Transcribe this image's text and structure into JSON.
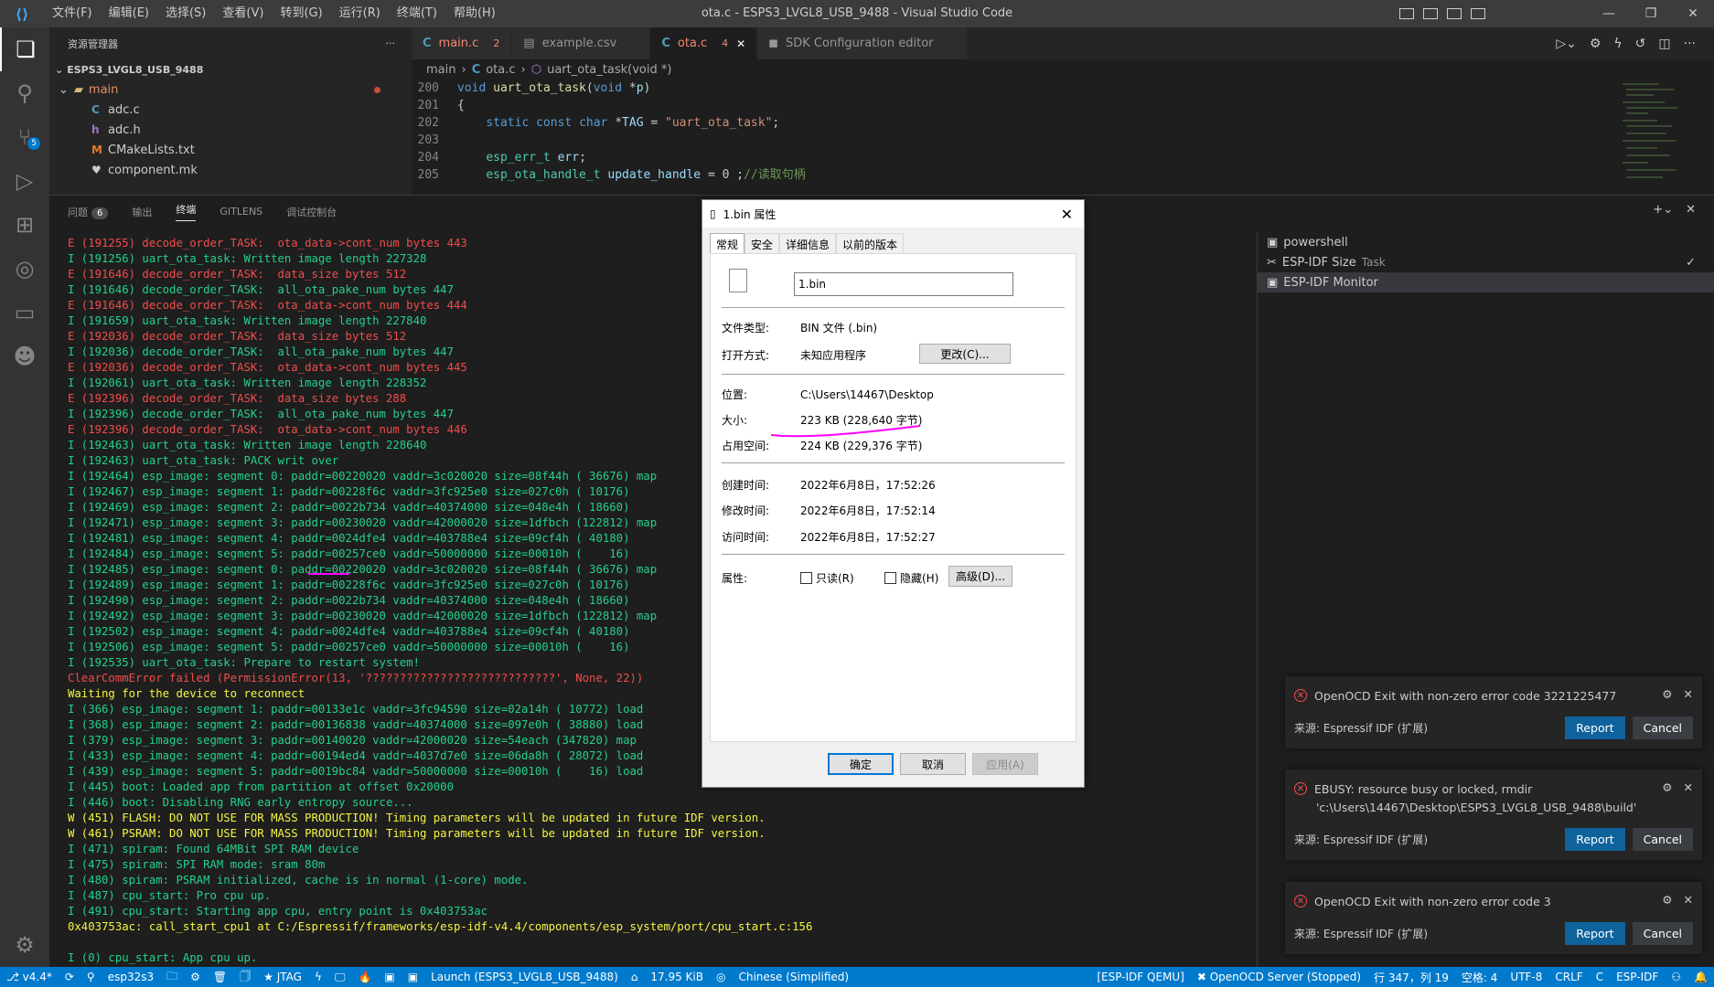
{
  "titlebar": {
    "menu": [
      "文件(F)",
      "编辑(E)",
      "选择(S)",
      "查看(V)",
      "转到(G)",
      "运行(R)",
      "终端(T)",
      "帮助(H)"
    ],
    "title": "ota.c - ESPS3_LVGL8_USB_9488 - Visual Studio Code"
  },
  "activity": {
    "scm_badge": "5"
  },
  "sidebar": {
    "title": "资源管理器",
    "more": "···",
    "project": "ESPS3_LVGL8_USB_9488",
    "folder": "main",
    "files": [
      {
        "icon": "C",
        "name": "adc.c",
        "color": "#519aba"
      },
      {
        "icon": "h",
        "name": "adc.h",
        "color": "#a074c4"
      },
      {
        "icon": "M",
        "name": "CMakeLists.txt",
        "color": "#e37933"
      },
      {
        "icon": "♥",
        "name": "component.mk",
        "color": "#cccccc"
      }
    ]
  },
  "tabs": [
    {
      "icon": "C",
      "label": "main.c",
      "suffix": "2",
      "color": "#f48771",
      "active": false
    },
    {
      "icon": "▤",
      "label": "example.csv",
      "suffix": "",
      "color": "#969696",
      "active": false
    },
    {
      "icon": "C",
      "label": "ota.c",
      "suffix": "4",
      "color": "#f48771",
      "active": true
    },
    {
      "icon": "◼",
      "label": "SDK Configuration editor",
      "suffix": "",
      "color": "#969696",
      "active": false
    }
  ],
  "breadcrumb": {
    "a": "main",
    "b": "ota.c",
    "c": "uart_ota_task(void *)"
  },
  "code": [
    {
      "n": "200",
      "html": "void uart_ota_task(void *p)"
    },
    {
      "n": "201",
      "html": "{"
    },
    {
      "n": "202",
      "html": "    static const char *TAG = \"uart_ota_task\";"
    },
    {
      "n": "203",
      "html": ""
    },
    {
      "n": "204",
      "html": "    esp_err_t err;"
    },
    {
      "n": "205",
      "html": "    esp_ota_handle_t update_handle = 0 ;//读取句柄"
    }
  ],
  "panel": {
    "tabs": [
      "问题",
      "输出",
      "终端",
      "GITLENS",
      "调试控制台"
    ],
    "problems_count": "6",
    "active_tab": "终端"
  },
  "terminal_lines": [
    {
      "c": "red",
      "t": "E (191255) decode_order_TASK:  ota_data->cont_num bytes 443"
    },
    {
      "c": "green",
      "t": "I (191256) uart_ota_task: Written image length 227328"
    },
    {
      "c": "red",
      "t": "E (191646) decode_order_TASK:  data_size bytes 512"
    },
    {
      "c": "green",
      "t": "I (191646) decode_order_TASK:  all_ota_pake_num bytes 447"
    },
    {
      "c": "red",
      "t": "E (191646) decode_order_TASK:  ota_data->cont_num bytes 444"
    },
    {
      "c": "green",
      "t": "I (191659) uart_ota_task: Written image length 227840"
    },
    {
      "c": "red",
      "t": "E (192036) decode_order_TASK:  data_size bytes 512"
    },
    {
      "c": "green",
      "t": "I (192036) decode_order_TASK:  all_ota_pake_num bytes 447"
    },
    {
      "c": "red",
      "t": "E (192036) decode_order_TASK:  ota_data->cont_num bytes 445"
    },
    {
      "c": "green",
      "t": "I (192061) uart_ota_task: Written image length 228352"
    },
    {
      "c": "red",
      "t": "E (192396) decode_order_TASK:  data_size bytes 288"
    },
    {
      "c": "green",
      "t": "I (192396) decode_order_TASK:  all_ota_pake_num bytes 447"
    },
    {
      "c": "red",
      "t": "E (192396) decode_order_TASK:  ota_data->cont_num bytes 446"
    },
    {
      "c": "green",
      "t": "I (192463) uart_ota_task: Written image length 228640"
    },
    {
      "c": "green",
      "t": "I (192463) uart_ota_task: PACK writ over"
    },
    {
      "c": "green",
      "t": "I (192464) esp_image: segment 0: paddr=00220020 vaddr=3c020020 size=08f44h ( 36676) map"
    },
    {
      "c": "green",
      "t": "I (192467) esp_image: segment 1: paddr=00228f6c vaddr=3fc925e0 size=027c0h ( 10176)"
    },
    {
      "c": "green",
      "t": "I (192469) esp_image: segment 2: paddr=0022b734 vaddr=40374000 size=048e4h ( 18660)"
    },
    {
      "c": "green",
      "t": "I (192471) esp_image: segment 3: paddr=00230020 vaddr=42000020 size=1dfbch (122812) map"
    },
    {
      "c": "green",
      "t": "I (192481) esp_image: segment 4: paddr=0024dfe4 vaddr=403788e4 size=09cf4h ( 40180)"
    },
    {
      "c": "green",
      "t": "I (192484) esp_image: segment 5: paddr=00257ce0 vaddr=50000000 size=00010h (    16)"
    },
    {
      "c": "green",
      "t": "I (192485) esp_image: segment 0: paddr=00220020 vaddr=3c020020 size=08f44h ( 36676) map"
    },
    {
      "c": "green",
      "t": "I (192489) esp_image: segment 1: paddr=00228f6c vaddr=3fc925e0 size=027c0h ( 10176)"
    },
    {
      "c": "green",
      "t": "I (192490) esp_image: segment 2: paddr=0022b734 vaddr=40374000 size=048e4h ( 18660)"
    },
    {
      "c": "green",
      "t": "I (192492) esp_image: segment 3: paddr=00230020 vaddr=42000020 size=1dfbch (122812) map"
    },
    {
      "c": "green",
      "t": "I (192502) esp_image: segment 4: paddr=0024dfe4 vaddr=403788e4 size=09cf4h ( 40180)"
    },
    {
      "c": "green",
      "t": "I (192506) esp_image: segment 5: paddr=00257ce0 vaddr=50000000 size=00010h (    16)"
    },
    {
      "c": "green",
      "t": "I (192535) uart_ota_task: Prepare to restart system!"
    },
    {
      "c": "red",
      "t": "ClearCommError failed (PermissionError(13, '????????????????????????????', None, 22))"
    },
    {
      "c": "yellow",
      "t": "Waiting for the device to reconnect"
    },
    {
      "c": "green",
      "t": "I (366) esp_image: segment 1: paddr=00133e1c vaddr=3fc94590 size=02a14h ( 10772) load"
    },
    {
      "c": "green",
      "t": "I (368) esp_image: segment 2: paddr=00136838 vaddr=40374000 size=097e0h ( 38880) load"
    },
    {
      "c": "green",
      "t": "I (379) esp_image: segment 3: paddr=00140020 vaddr=42000020 size=54each (347820) map"
    },
    {
      "c": "green",
      "t": "I (433) esp_image: segment 4: paddr=00194ed4 vaddr=4037d7e0 size=06da8h ( 28072) load"
    },
    {
      "c": "green",
      "t": "I (439) esp_image: segment 5: paddr=0019bc84 vaddr=50000000 size=00010h (    16) load"
    },
    {
      "c": "green",
      "t": "I (445) boot: Loaded app from partition at offset 0x20000"
    },
    {
      "c": "green",
      "t": "I (446) boot: Disabling RNG early entropy source..."
    },
    {
      "c": "yellow",
      "t": "W (451) FLASH: DO NOT USE FOR MASS PRODUCTION! Timing parameters will be updated in future IDF version."
    },
    {
      "c": "yellow",
      "t": "W (461) PSRAM: DO NOT USE FOR MASS PRODUCTION! Timing parameters will be updated in future IDF version."
    },
    {
      "c": "green",
      "t": "I (471) spiram: Found 64MBit SPI RAM device"
    },
    {
      "c": "green",
      "t": "I (475) spiram: SPI RAM mode: sram 80m"
    },
    {
      "c": "green",
      "t": "I (480) spiram: PSRAM initialized, cache is in normal (1-core) mode."
    },
    {
      "c": "green",
      "t": "I (487) cpu_start: Pro cpu up."
    },
    {
      "c": "green",
      "t": "I (491) cpu_start: Starting app cpu, entry point is 0x403753ac"
    },
    {
      "c": "yellow",
      "t": "0x403753ac: call_start_cpu1 at C:/Espressif/frameworks/esp-idf-v4.4/components/esp_system/port/cpu_start.c:156"
    },
    {
      "c": "plain",
      "t": ""
    },
    {
      "c": "green",
      "t": "I (0) cpu_start: App cpu up."
    }
  ],
  "terminals": [
    {
      "name": "powershell",
      "sub": "",
      "sel": false,
      "check": false
    },
    {
      "name": "ESP-IDF Size",
      "sub": "Task",
      "sel": false,
      "check": true
    },
    {
      "name": "ESP-IDF Monitor",
      "sub": "",
      "sel": true,
      "check": false
    }
  ],
  "notifications": [
    {
      "msg": "OpenOCD Exit with non-zero error code 3221225477",
      "msg2": "",
      "source": "来源: Espressif IDF (扩展)",
      "report": "Report",
      "cancel": "Cancel"
    },
    {
      "msg": "EBUSY: resource busy or locked, rmdir",
      "msg2": "'c:\\Users\\14467\\Desktop\\ESPS3_LVGL8_USB_9488\\build'",
      "source": "来源: Espressif IDF (扩展)",
      "report": "Report",
      "cancel": "Cancel"
    },
    {
      "msg": "OpenOCD Exit with non-zero error code 3",
      "msg2": "",
      "source": "来源: Espressif IDF (扩展)",
      "report": "Report",
      "cancel": "Cancel"
    }
  ],
  "dialog": {
    "title": "1.bin 属性",
    "tabs": [
      "常规",
      "安全",
      "详细信息",
      "以前的版本"
    ],
    "filename": "1.bin",
    "type_label": "文件类型:",
    "type_value": "BIN 文件 (.bin)",
    "open_label": "打开方式:",
    "open_value": "未知应用程序",
    "change_btn": "更改(C)...",
    "loc_label": "位置:",
    "loc_value": "C:\\Users\\14467\\Desktop",
    "size_label": "大小:",
    "size_value": "223 KB (228,640 字节)",
    "disk_label": "占用空间:",
    "disk_value": "224 KB (229,376 字节)",
    "created_label": "创建时间:",
    "created_value": "2022年6月8日，17:52:26",
    "modified_label": "修改时间:",
    "modified_value": "2022年6月8日，17:52:14",
    "accessed_label": "访问时间:",
    "accessed_value": "2022年6月8日，17:52:27",
    "attr_label": "属性:",
    "readonly": "只读(R)",
    "hidden": "隐藏(H)",
    "advanced": "高级(D)...",
    "ok": "确定",
    "cancel": "取消",
    "apply": "应用(A)"
  },
  "statusbar": {
    "left": [
      "⎇ v4.4*",
      "⟳",
      "⚲",
      "esp32s3",
      "🗀",
      "⚙",
      "🗑",
      "🗍",
      "★ JTAG",
      "ϟ",
      "🖵",
      "🔥",
      "▣",
      "▣",
      "Launch (ESPS3_LVGL8_USB_9488)",
      "⌂",
      "17.95 KiB",
      "◎",
      "Chinese (Simplified)"
    ],
    "right": [
      "[ESP-IDF QEMU]",
      "✖ OpenOCD Server (Stopped)",
      "行 347，列 19",
      "空格: 4",
      "UTF-8",
      "CRLF",
      "C",
      "ESP-IDF",
      "⚇",
      "🔔"
    ]
  }
}
